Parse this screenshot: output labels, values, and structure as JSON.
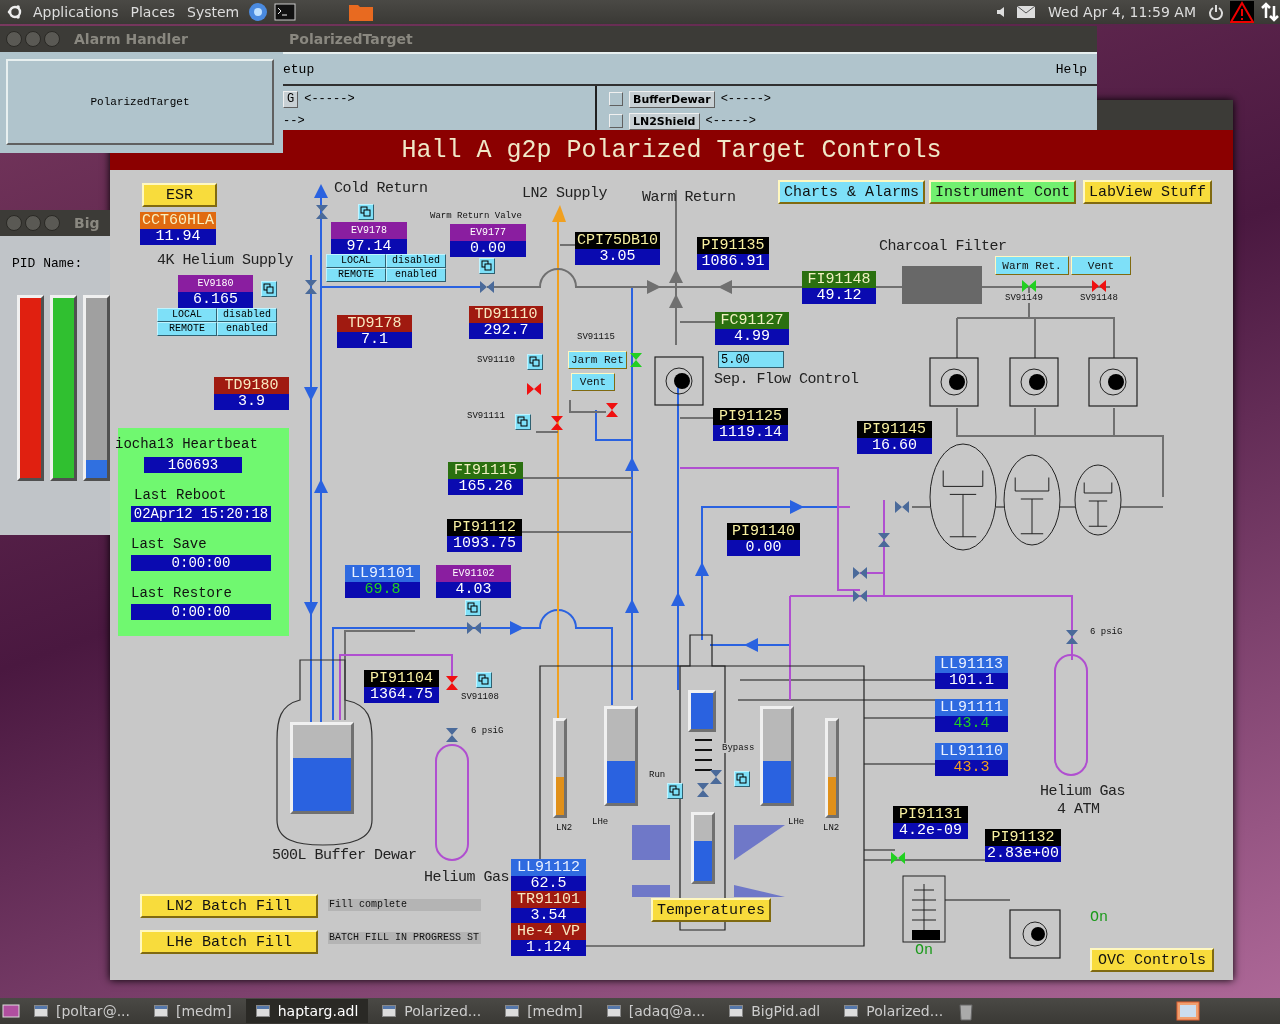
{
  "top_panel": {
    "menus": [
      "Applications",
      "Places",
      "System"
    ],
    "clock": "Wed Apr  4, 11:59 AM"
  },
  "alarm_window": {
    "title": "Alarm Handler",
    "group_button": "PolarizedTarget"
  },
  "target_window": {
    "title": "PolarizedTarget",
    "menu_left": "etup",
    "menu_right": "Help",
    "rows_left": [
      {
        "button": "G",
        "arrow": "<----->"
      },
      {
        "arrow": "-->"
      }
    ],
    "rows_right": [
      {
        "checked": false,
        "button": "BufferDewar",
        "arrow": "<----->"
      },
      {
        "checked": false,
        "button": "LN2Shield",
        "arrow": "<----->"
      }
    ]
  },
  "pid_window": {
    "title": "Big",
    "pid_label": "PID Name:",
    "bars": [
      {
        "color": "#e02010",
        "level": 1
      },
      {
        "color": "#30c030",
        "level": 1
      },
      {
        "color": "#3070e0",
        "level": 0.1
      }
    ]
  },
  "main_window": {
    "header": "Hall A g2p Polarized Target Controls",
    "buttons": [
      {
        "label": "ESR",
        "color": "#f8dc3c"
      },
      {
        "label": "Charts & Alarms",
        "color": "#7ee0f8"
      },
      {
        "label": "Instrument Cont",
        "color": "#72f070"
      },
      {
        "label": "LabView Stuff",
        "color": "#f8dc3c"
      },
      {
        "label": "Warm Ret.",
        "color": "#7ee0f8"
      },
      {
        "label": "Vent",
        "color": "#7ee0f8"
      },
      {
        "label": "Jarm Ret",
        "color": "#7ee0f8"
      },
      {
        "label": "Vent",
        "color": "#7ee0f8"
      },
      {
        "label": "Temperatures",
        "color": "#f8dc3c"
      },
      {
        "label": "LN2 Batch Fill",
        "color": "#f8dc3c"
      },
      {
        "label": "LHe Batch Fill",
        "color": "#f8dc3c"
      },
      {
        "label": "OVC Controls",
        "color": "#f8dc3c"
      }
    ],
    "readouts": [
      {
        "label": "CCT60HLA",
        "value": "11.94",
        "kind": "controller",
        "alarm_color": false,
        "minor": false
      },
      {
        "label": "EV9178",
        "value": "97.14",
        "kind": "valve",
        "alarm_color": false,
        "minor": false
      },
      {
        "label": "EV9177",
        "value": "0.00",
        "kind": "valve",
        "alarm_color": false,
        "minor": false
      },
      {
        "label": "CPI75DB10",
        "value": "3.05",
        "kind": "pressure",
        "alarm_color": false,
        "minor": false
      },
      {
        "label": "EV9180",
        "value": "6.165",
        "kind": "valve",
        "alarm_color": false,
        "minor": false
      },
      {
        "label": "TD91110",
        "value": "292.7",
        "kind": "temperature",
        "alarm_color": false,
        "minor": false
      },
      {
        "label": "TD9178",
        "value": "7.1",
        "kind": "temperature",
        "alarm_color": false,
        "minor": false
      },
      {
        "label": "PI91135",
        "value": "1086.91",
        "kind": "pressure",
        "alarm_color": false,
        "minor": false
      },
      {
        "label": "FI91148",
        "value": "49.12",
        "kind": "flow",
        "alarm_color": false,
        "minor": false
      },
      {
        "label": "FC91127",
        "value": "4.99",
        "kind": "flow",
        "alarm_color": false,
        "minor": false
      },
      {
        "label": "TD9180",
        "value": "3.9",
        "kind": "temperature",
        "alarm_color": false,
        "minor": false
      },
      {
        "label": "PI91125",
        "value": "1119.14",
        "kind": "pressure",
        "alarm_color": false,
        "minor": false
      },
      {
        "label": "PI91145",
        "value": "16.60",
        "kind": "pressure",
        "alarm_color": false,
        "minor": false
      },
      {
        "label": "FI91115",
        "value": "165.26",
        "kind": "flow",
        "alarm_color": false,
        "minor": false
      },
      {
        "label": "PI91112",
        "value": "1093.75",
        "kind": "pressure",
        "alarm_color": false,
        "minor": false
      },
      {
        "label": "PI91140",
        "value": "0.00",
        "kind": "pressure",
        "alarm_color": false,
        "minor": false
      },
      {
        "label": "LL91101",
        "value": "69.8",
        "kind": "level",
        "alarm_color": true,
        "minor": false
      },
      {
        "label": "EV91102",
        "value": "4.03",
        "kind": "valve",
        "alarm_color": false,
        "minor": false
      },
      {
        "label": "LL91113",
        "value": "101.1",
        "kind": "level",
        "alarm_color": false,
        "minor": false
      },
      {
        "label": "PI91104",
        "value": "1364.75",
        "kind": "pressure",
        "alarm_color": false,
        "minor": false
      },
      {
        "label": "LL91111",
        "value": "43.4",
        "kind": "level",
        "alarm_color": true,
        "minor": false
      },
      {
        "label": "LL91110",
        "value": "43.3",
        "kind": "level",
        "alarm_color": true,
        "minor": true
      },
      {
        "label": "PI91131",
        "value": "4.2e-09",
        "kind": "pressure",
        "alarm_color": false,
        "minor": false
      },
      {
        "label": "PI91132",
        "value": "2.83e+00",
        "kind": "pressure",
        "alarm_color": false,
        "minor": false
      },
      {
        "label": "LL91112",
        "value": "62.5",
        "kind": "level",
        "alarm_color": false,
        "minor": false
      },
      {
        "label": "TR91101",
        "value": "3.54",
        "kind": "temperature",
        "alarm_color": false,
        "minor": false
      },
      {
        "label": "He-4 VP",
        "value": "1.124",
        "kind": "temperature",
        "alarm_color": false,
        "minor": false
      }
    ],
    "mode_panels": [
      {
        "cells": [
          "LOCAL",
          "disabled",
          "REMOTE",
          "enabled"
        ]
      },
      {
        "cells": [
          "LOCAL",
          "disabled",
          "REMOTE",
          "enabled"
        ]
      }
    ],
    "setpoint": {
      "value": "5.00"
    },
    "labels": [
      {
        "text": "Cold Return",
        "kind": "heading"
      },
      {
        "text": "LN2 Supply",
        "kind": "heading"
      },
      {
        "text": "Warm Return",
        "kind": "heading"
      },
      {
        "text": "4K Helium Supply",
        "kind": "heading"
      },
      {
        "text": "Charcoal Filter",
        "kind": "heading"
      },
      {
        "text": "Sep. Flow Control",
        "kind": "heading"
      },
      {
        "text": "500L Buffer Dewar",
        "kind": "heading"
      },
      {
        "text": "Helium Gas",
        "kind": "heading"
      },
      {
        "text": "Helium Gas",
        "kind": "heading"
      },
      {
        "text": "4 ATM",
        "kind": "heading"
      },
      {
        "text": "Warm Return Valve",
        "kind": "small"
      },
      {
        "text": "SV91115",
        "kind": "small"
      },
      {
        "text": "SV91110",
        "kind": "small"
      },
      {
        "text": "SV91111",
        "kind": "small"
      },
      {
        "text": "SV91149",
        "kind": "small"
      },
      {
        "text": "SV91148",
        "kind": "small"
      },
      {
        "text": "SV91108",
        "kind": "small"
      },
      {
        "text": "6 psiG",
        "kind": "small"
      },
      {
        "text": "6 psiG",
        "kind": "small"
      },
      {
        "text": "LN2",
        "kind": "small"
      },
      {
        "text": "LHe",
        "kind": "small"
      },
      {
        "text": "Run",
        "kind": "small"
      },
      {
        "text": "Bypass",
        "kind": "small"
      },
      {
        "text": "LHe",
        "kind": "small"
      },
      {
        "text": "LN2",
        "kind": "small"
      },
      {
        "text": "On",
        "kind": "status"
      },
      {
        "text": "On",
        "kind": "status"
      }
    ],
    "valves": [
      {
        "open": true
      },
      {
        "open": false
      },
      {
        "open": false
      },
      {
        "open": false
      },
      {
        "open": true
      },
      {
        "open": false
      },
      {
        "open": false
      },
      {
        "open": true
      }
    ],
    "gauges": [
      {
        "kind": "lhe",
        "level": 0.62
      },
      {
        "kind": "ln2",
        "level": 0.4
      },
      {
        "kind": "lhe",
        "level": 0.45
      },
      {
        "kind": "lhe",
        "level": 1
      },
      {
        "kind": "lhe",
        "level": 0.6
      },
      {
        "kind": "lhe",
        "level": 0.45
      },
      {
        "kind": "ln2",
        "level": 0.4
      }
    ],
    "fill_status": [
      "Fill complete",
      "BATCH FILL IN PROGRESS ST"
    ],
    "heartbeat": {
      "title": "iocha13 Heartbeat",
      "count": "160693",
      "items": [
        {
          "label": "Last Reboot",
          "value": "02Apr12 15:20:18"
        },
        {
          "label": "Last Save",
          "value": "0:00:00"
        },
        {
          "label": "Last Restore",
          "value": "0:00:00"
        }
      ]
    }
  },
  "taskbar": [
    {
      "label": "[poltar@...",
      "selected": false
    },
    {
      "label": "[medm]",
      "selected": false
    },
    {
      "label": "haptarg.adl",
      "selected": true
    },
    {
      "label": "Polarized...",
      "selected": false
    },
    {
      "label": "[medm]",
      "selected": false
    },
    {
      "label": "[adaq@a...",
      "selected": false
    },
    {
      "label": "BigPid.adl",
      "selected": false
    },
    {
      "label": "Polarized...",
      "selected": false
    }
  ]
}
